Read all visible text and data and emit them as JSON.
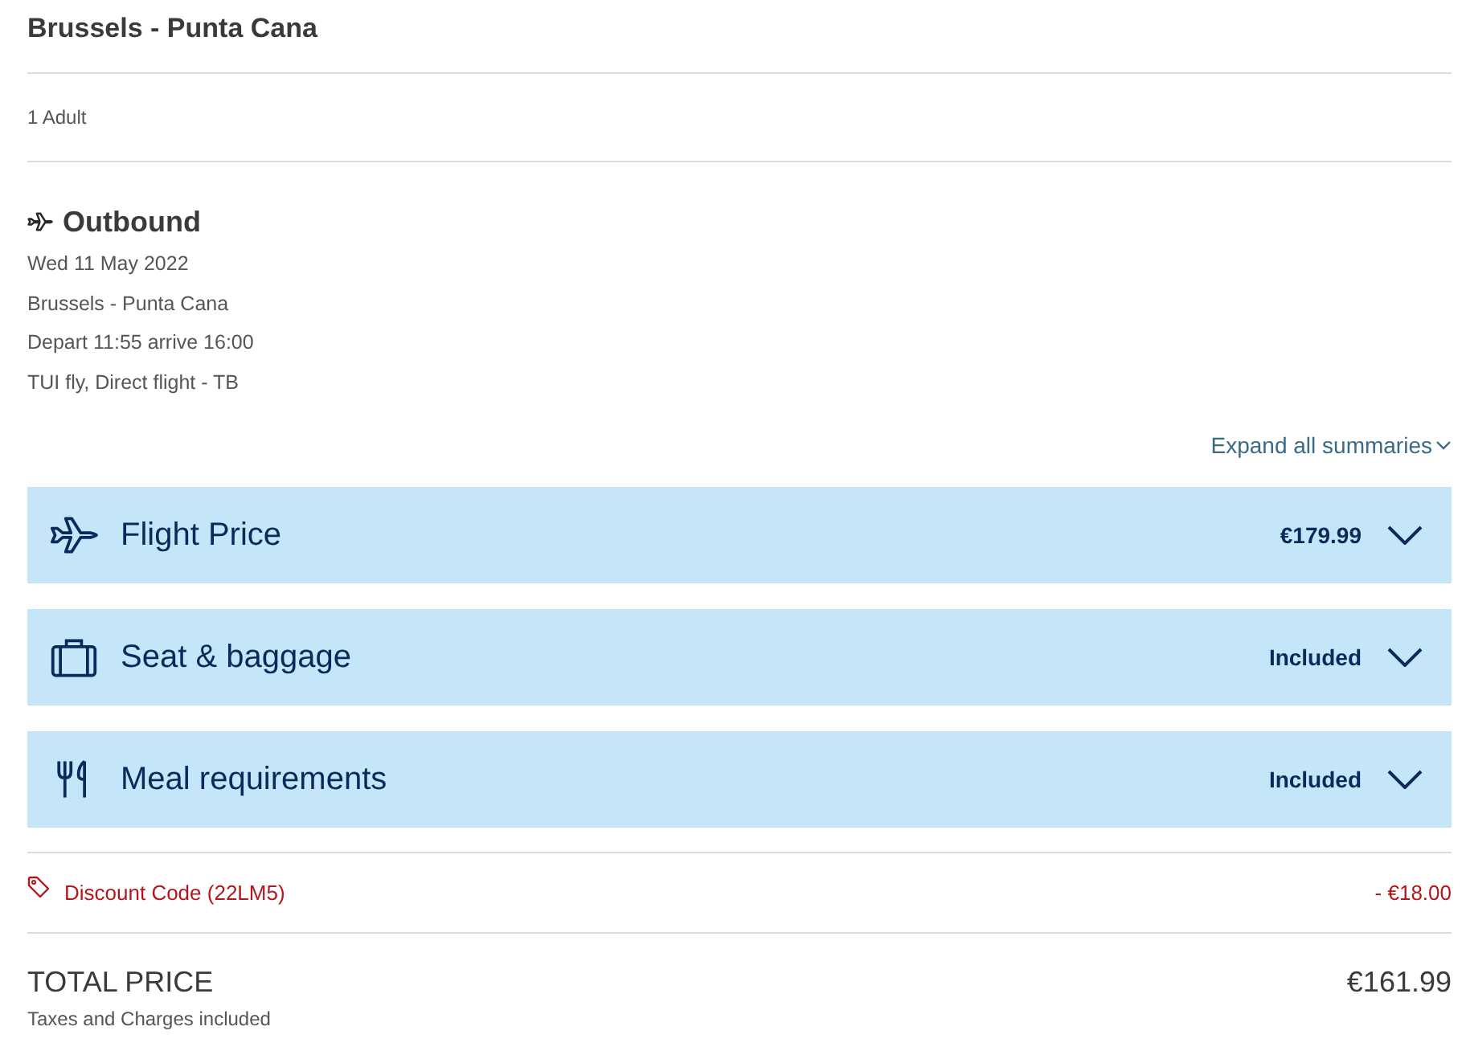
{
  "header": {
    "title": "Brussels - Punta Cana",
    "passengers": "1 Adult"
  },
  "outbound": {
    "title": "Outbound",
    "details": [
      "Wed 11 May 2022",
      "Brussels - Punta Cana",
      "Depart 11:55 arrive 16:00",
      "TUI fly, Direct flight - TB"
    ]
  },
  "expand_all": {
    "label": "Expand all summaries"
  },
  "panels": [
    {
      "kind": "flight",
      "label": "Flight Price",
      "value": "€179.99",
      "expanded": false
    },
    {
      "kind": "baggage",
      "label": "Seat & baggage",
      "value": "Included",
      "expanded": false
    },
    {
      "kind": "meal",
      "label": "Meal requirements",
      "value": "Included",
      "expanded": false
    }
  ],
  "discount": {
    "label": "Discount Code (22LM5)",
    "amount": "- €18.00"
  },
  "total": {
    "label": "TOTAL PRICE",
    "note": "Taxes and Charges included",
    "amount": "€161.99"
  }
}
